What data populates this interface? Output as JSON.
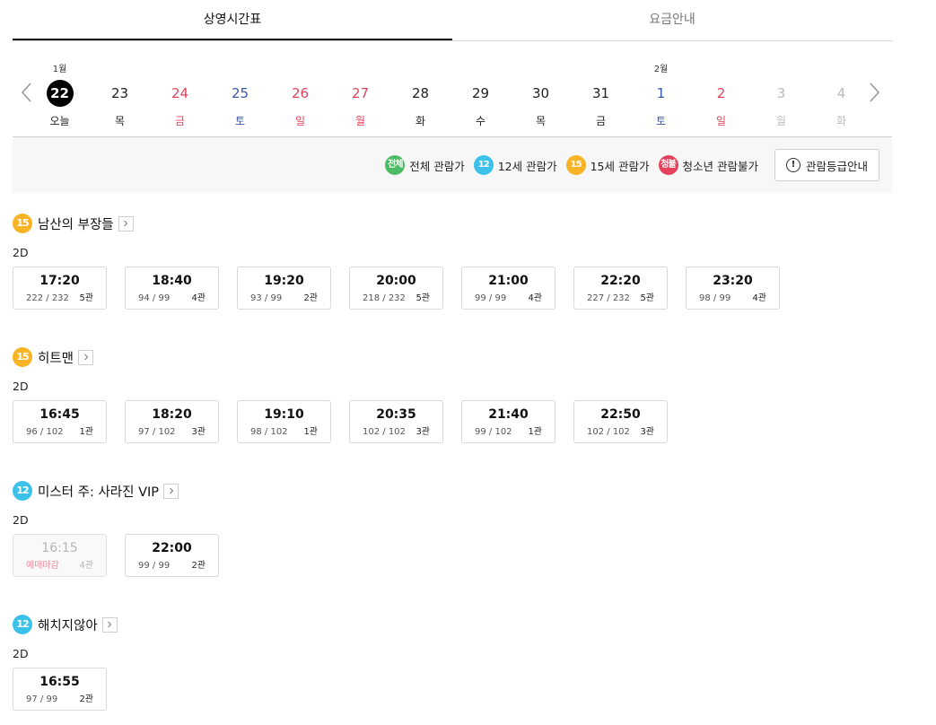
{
  "tabs": [
    "상영시간표",
    "요금안내"
  ],
  "dates": [
    {
      "month": "1월",
      "day": "22",
      "dow": "오늘",
      "color": "black",
      "selected": true
    },
    {
      "month": "",
      "day": "23",
      "dow": "목",
      "color": "black"
    },
    {
      "month": "",
      "day": "24",
      "dow": "금",
      "color": "red"
    },
    {
      "month": "",
      "day": "25",
      "dow": "토",
      "color": "blue"
    },
    {
      "month": "",
      "day": "26",
      "dow": "일",
      "color": "red"
    },
    {
      "month": "",
      "day": "27",
      "dow": "월",
      "color": "red"
    },
    {
      "month": "",
      "day": "28",
      "dow": "화",
      "color": "black"
    },
    {
      "month": "",
      "day": "29",
      "dow": "수",
      "color": "black"
    },
    {
      "month": "",
      "day": "30",
      "dow": "목",
      "color": "black"
    },
    {
      "month": "",
      "day": "31",
      "dow": "금",
      "color": "black"
    },
    {
      "month": "2월",
      "day": "1",
      "dow": "토",
      "color": "blue"
    },
    {
      "month": "",
      "day": "2",
      "dow": "일",
      "color": "red"
    },
    {
      "month": "",
      "day": "3",
      "dow": "월",
      "color": "gray"
    },
    {
      "month": "",
      "day": "4",
      "dow": "화",
      "color": "gray"
    }
  ],
  "legend": [
    {
      "badge": "전체",
      "label": "전체 관람가",
      "color": "#4cbb63"
    },
    {
      "badge": "12",
      "label": "12세 관람가",
      "color": "#3bc1ea"
    },
    {
      "badge": "15",
      "label": "15세 관람가",
      "color": "#f8b425"
    },
    {
      "badge": "청불",
      "label": "청소년 관람불가",
      "color": "#e5415d"
    }
  ],
  "grade_button": {
    "icon": "!",
    "label": "관람등급안내"
  },
  "movies": [
    {
      "rating": "15",
      "rating_color": "#f8b425",
      "title": "남산의 부장들",
      "format": "2D",
      "showtimes": [
        {
          "time": "17:20",
          "seats": "222 / 232",
          "hall": "5관"
        },
        {
          "time": "18:40",
          "seats": "94 / 99",
          "hall": "4관"
        },
        {
          "time": "19:20",
          "seats": "93 / 99",
          "hall": "2관"
        },
        {
          "time": "20:00",
          "seats": "218 / 232",
          "hall": "5관"
        },
        {
          "time": "21:00",
          "seats": "99 / 99",
          "hall": "4관"
        },
        {
          "time": "22:20",
          "seats": "227 / 232",
          "hall": "5관"
        },
        {
          "time": "23:20",
          "seats": "98 / 99",
          "hall": "4관"
        }
      ]
    },
    {
      "rating": "15",
      "rating_color": "#f8b425",
      "title": "히트맨",
      "format": "2D",
      "showtimes": [
        {
          "time": "16:45",
          "seats": "96 / 102",
          "hall": "1관"
        },
        {
          "time": "18:20",
          "seats": "97 / 102",
          "hall": "3관"
        },
        {
          "time": "19:10",
          "seats": "98 / 102",
          "hall": "1관"
        },
        {
          "time": "20:35",
          "seats": "102 / 102",
          "hall": "3관"
        },
        {
          "time": "21:40",
          "seats": "99 / 102",
          "hall": "1관"
        },
        {
          "time": "22:50",
          "seats": "102 / 102",
          "hall": "3관"
        }
      ]
    },
    {
      "rating": "12",
      "rating_color": "#3bc1ea",
      "title": "미스터 주: 사라진 VIP",
      "format": "2D",
      "showtimes": [
        {
          "time": "16:15",
          "seats": "예매마감",
          "hall": "4관",
          "closed": true
        },
        {
          "time": "22:00",
          "seats": "99 / 99",
          "hall": "2관"
        }
      ]
    },
    {
      "rating": "12",
      "rating_color": "#3bc1ea",
      "title": "해치지않아",
      "format": "2D",
      "showtimes": [
        {
          "time": "16:55",
          "seats": "97 / 99",
          "hall": "2관"
        }
      ]
    }
  ]
}
